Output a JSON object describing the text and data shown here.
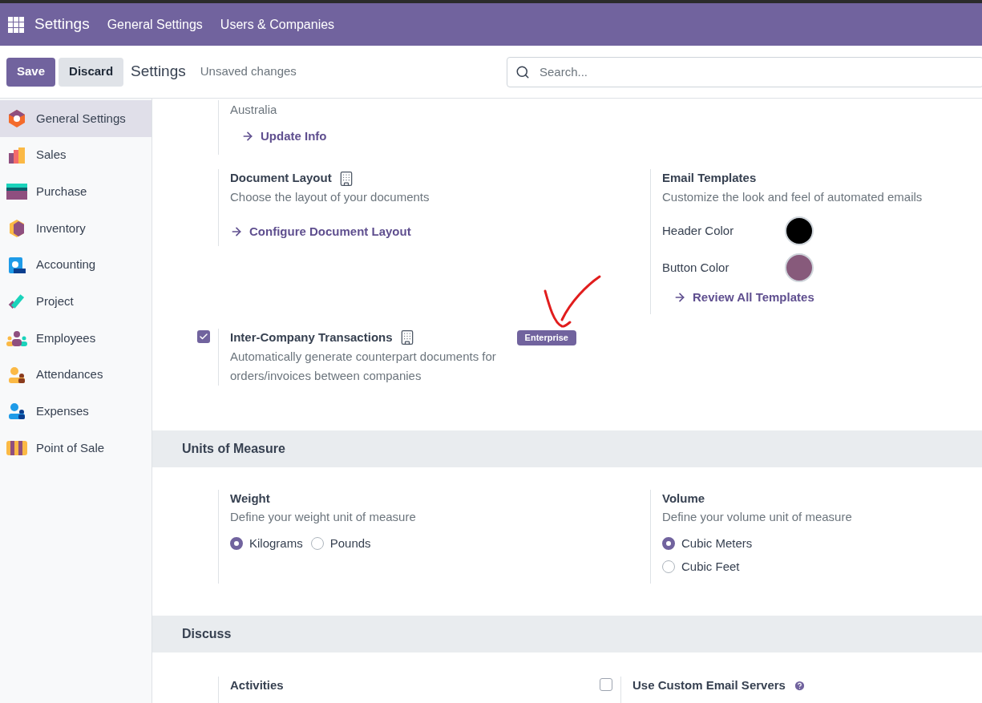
{
  "navbar": {
    "app_name": "Settings",
    "menu": [
      {
        "label": "General Settings"
      },
      {
        "label": "Users & Companies"
      }
    ]
  },
  "control_bar": {
    "save": "Save",
    "discard": "Discard",
    "title": "Settings",
    "status": "Unsaved changes"
  },
  "search": {
    "placeholder": "Search..."
  },
  "sidebar": {
    "items": [
      {
        "label": "General Settings",
        "selected": true
      },
      {
        "label": "Sales",
        "selected": false
      },
      {
        "label": "Purchase",
        "selected": false
      },
      {
        "label": "Inventory",
        "selected": false
      },
      {
        "label": "Accounting",
        "selected": false
      },
      {
        "label": "Project",
        "selected": false
      },
      {
        "label": "Employees",
        "selected": false
      },
      {
        "label": "Attendances",
        "selected": false
      },
      {
        "label": "Expenses",
        "selected": false
      },
      {
        "label": "Point of Sale",
        "selected": false
      }
    ]
  },
  "company": {
    "country": "Australia",
    "link": "Update Info"
  },
  "document_layout": {
    "title": "Document Layout",
    "description": "Choose the layout of your documents",
    "link": "Configure Document Layout"
  },
  "email_templates": {
    "title": "Email Templates",
    "description": "Customize the look and feel of automated emails",
    "colors": [
      {
        "label": "Header Color",
        "color": "#000000"
      },
      {
        "label": "Button Color",
        "color": "#875a7b"
      }
    ],
    "link": "Review All Templates"
  },
  "inter_company": {
    "title": "Inter-Company Transactions",
    "checked": true,
    "badge": "Enterprise",
    "description": "Automatically generate counterpart documents for orders/invoices between companies"
  },
  "units_of_measure": {
    "heading": "Units of Measure",
    "settings": [
      {
        "title": "Weight",
        "description": "Define your weight unit of measure",
        "kind": "inline",
        "options": [
          {
            "label": "Kilograms",
            "selected": true
          },
          {
            "label": "Pounds",
            "selected": false
          }
        ]
      },
      {
        "title": "Volume",
        "description": "Define your volume unit of measure",
        "kind": "stacked",
        "options": [
          {
            "label": "Cubic Meters",
            "selected": true
          },
          {
            "label": "Cubic Feet",
            "selected": false
          }
        ]
      }
    ]
  },
  "discuss": {
    "heading": "Discuss",
    "settings": [
      {
        "title": "Activities",
        "kind": "plain"
      },
      {
        "title": "Use Custom Email Servers",
        "kind": "checkbox",
        "checked": false,
        "help": true
      }
    ]
  }
}
